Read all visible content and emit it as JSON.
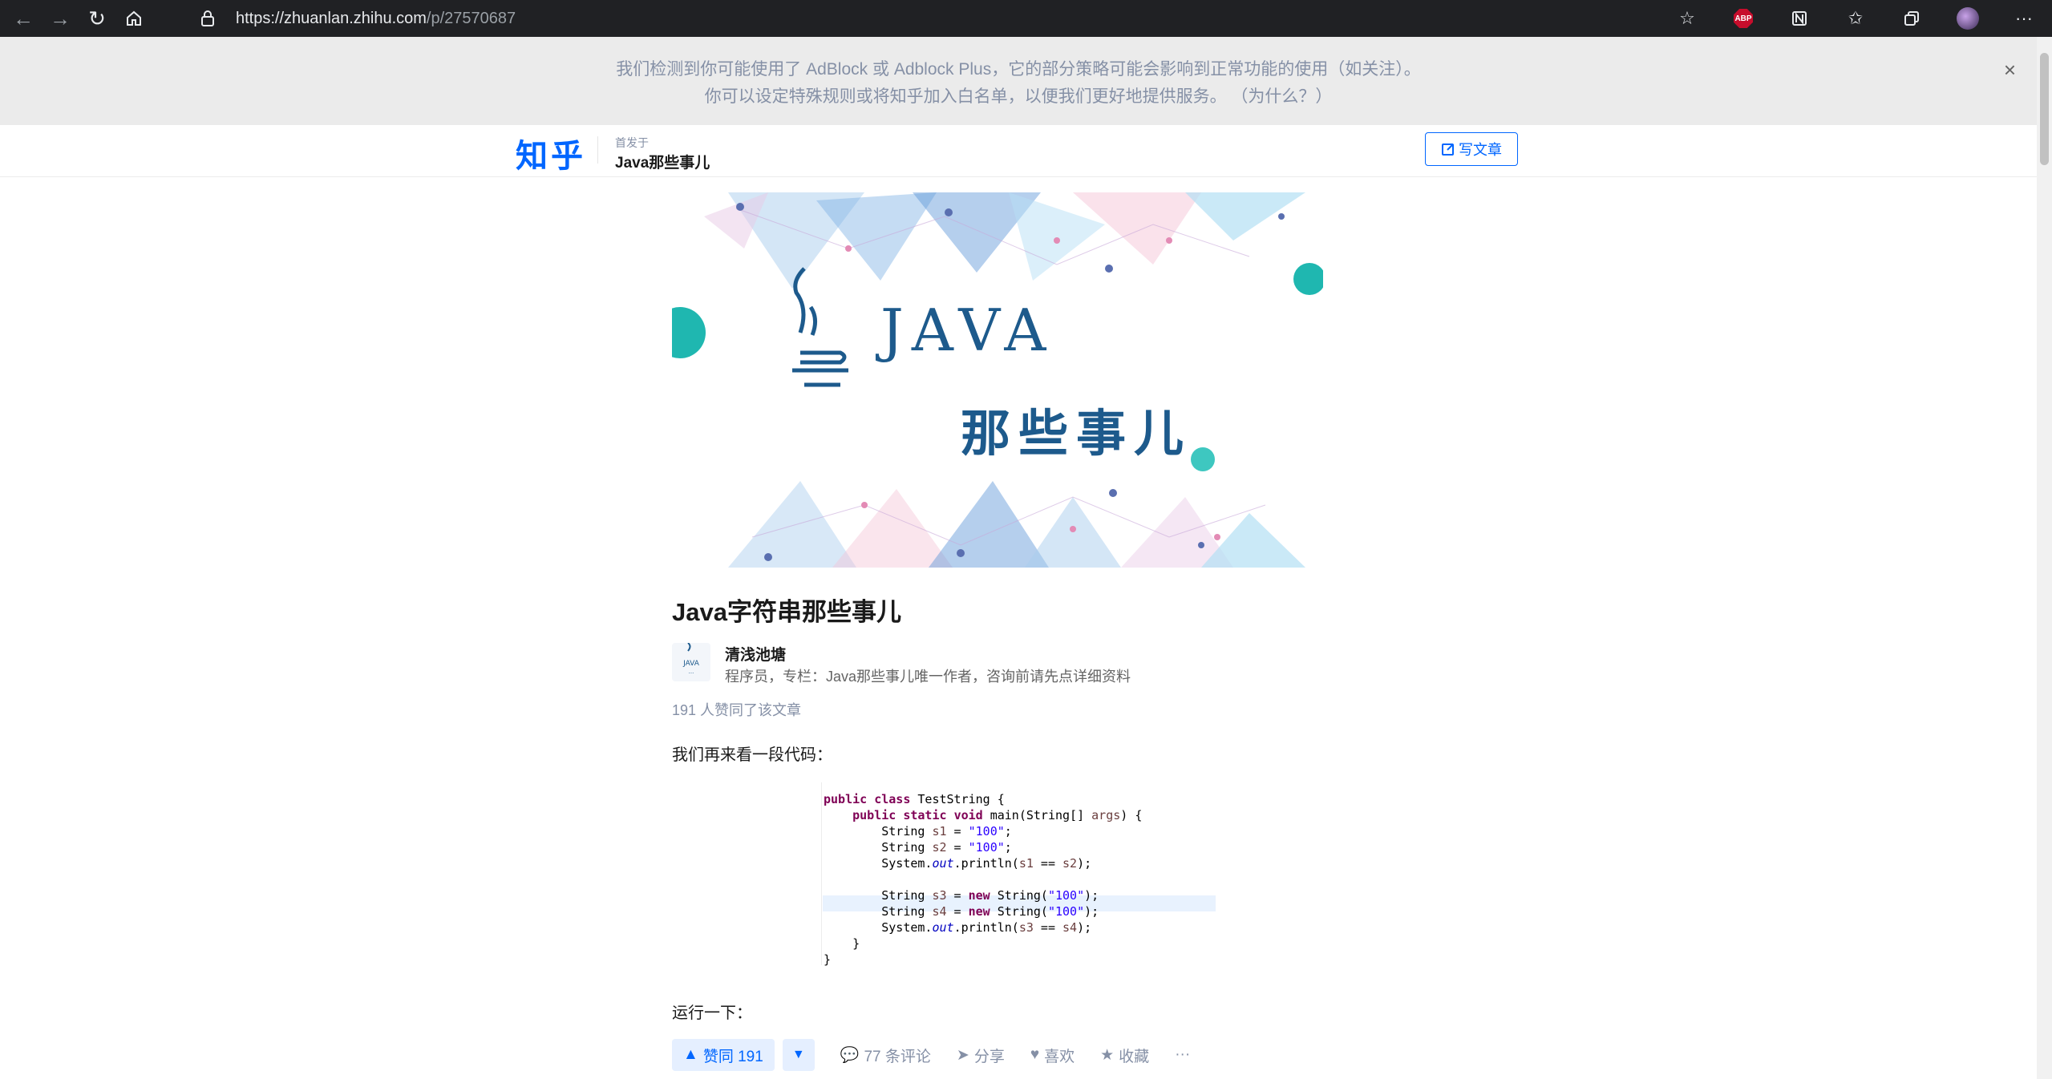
{
  "browser": {
    "url_host": "https://zhuanlan.zhihu.com",
    "url_path": "/p/27570687",
    "ext_abp_label": "ABP"
  },
  "adblock_notice": {
    "line1": "我们检测到你可能使用了 AdBlock 或 Adblock Plus，它的部分策略可能会影响到正常功能的使用（如关注）。",
    "line2": "你可以设定特殊规则或将知乎加入白名单，以便我们更好地提供服务。 （为什么？）",
    "close": "×"
  },
  "header": {
    "logo": "知乎",
    "first_published": "首发于",
    "column_name": "Java那些事儿",
    "write_button": "写文章"
  },
  "cover": {
    "java_text": "JAVA",
    "cn_text": "那些事儿"
  },
  "article": {
    "title": "Java字符串那些事儿",
    "author_name": "清浅池塘",
    "author_desc": "程序员，专栏：Java那些事儿唯一作者，咨询前请先点详细资料",
    "voters": "191 人赞同了该文章",
    "para1": "我们再来看一段代码：",
    "para2": "运行一下："
  },
  "code": {
    "lines": [
      "public class TestString {",
      "    public static void main(String[] args) {",
      "        String s1 = \"100\";",
      "        String s2 = \"100\";",
      "        System.out.println(s1 == s2);",
      "",
      "        String s3 = new String(\"100\");",
      "        String s4 = new String(\"100\");",
      "        System.out.println(s3 == s4);",
      "    }",
      "}"
    ]
  },
  "actions": {
    "vote_up": "赞同 191",
    "comments": "77 条评论",
    "share": "分享",
    "like": "喜欢",
    "collect": "收藏",
    "more": "···"
  }
}
